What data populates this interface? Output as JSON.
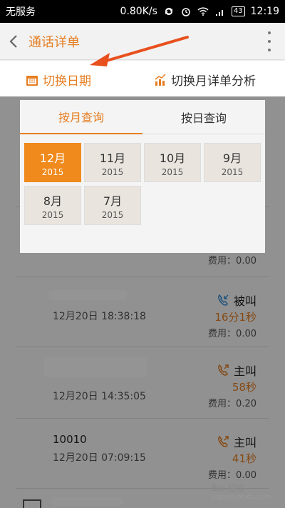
{
  "status_bar": {
    "carrier": "无服务",
    "speed": "0.80K/s",
    "battery": "43",
    "time": "12:19"
  },
  "header": {
    "title": "通话详单"
  },
  "toolbar": {
    "switch_date": "切换日期",
    "month_analysis": "切换月详单分析"
  },
  "panel": {
    "tabs": [
      "按月查询",
      "按日查询"
    ],
    "months": [
      {
        "month": "12月",
        "year": "2015",
        "selected": true
      },
      {
        "month": "11月",
        "year": "2015"
      },
      {
        "month": "10月",
        "year": "2015"
      },
      {
        "month": "9月",
        "year": "2015"
      },
      {
        "month": "8月",
        "year": "2015"
      },
      {
        "month": "7月",
        "year": "2015"
      }
    ]
  },
  "records": [
    {
      "name": "",
      "time": "",
      "type": "",
      "duration": "",
      "fee": "费用：0.00"
    },
    {
      "name": "",
      "time": "12月20日  18:38:18",
      "type": "被叫",
      "duration": "16分1秒",
      "fee": "费用：0.00"
    },
    {
      "name": "",
      "time": "12月20日  14:35:05",
      "type": "主叫",
      "duration": "58秒",
      "fee": "费用：0.20"
    },
    {
      "name": "10010",
      "time": "12月20日  07:09:15",
      "type": "主叫",
      "duration": "41秒",
      "fee": "费用：0.00"
    }
  ],
  "colors": {
    "accent": "#e67e22",
    "selected_month": "#f08a1c"
  },
  "watermark": {
    "brand": "Bai 经验",
    "url": "jingyan.baidu.com"
  }
}
